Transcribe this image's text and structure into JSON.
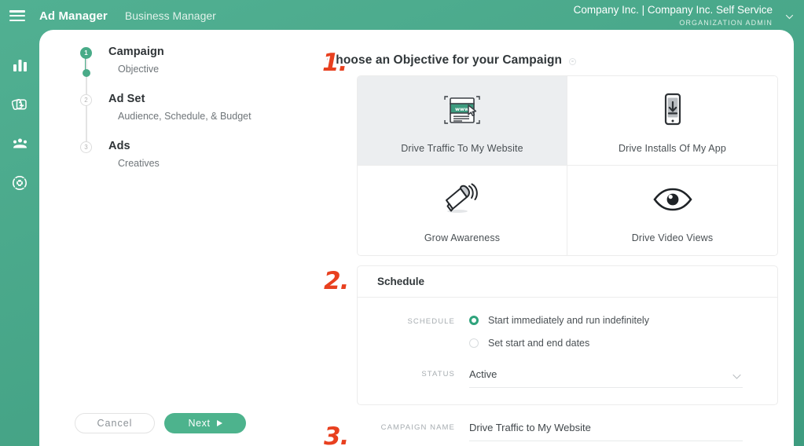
{
  "header": {
    "menu_icon": "hamburger-icon",
    "brand": "Ad Manager",
    "secondary_nav": "Business Manager",
    "org_line": "Company Inc.  |  Company Inc. Self Service",
    "org_role": "ORGANIZATION ADMIN",
    "caret_icon": "chevron-down-icon"
  },
  "rail": {
    "items": [
      {
        "icon": "bar-chart-icon",
        "name": "analytics"
      },
      {
        "icon": "ads-cards-icon",
        "name": "ads"
      },
      {
        "icon": "audience-people-icon",
        "name": "audience"
      },
      {
        "icon": "target-support-icon",
        "name": "support"
      }
    ]
  },
  "stepper": {
    "steps": [
      {
        "number": "1",
        "title": "Campaign",
        "sub": "Objective",
        "active": true
      },
      {
        "number": "2",
        "title": "Ad Set",
        "sub": "Audience, Schedule, & Budget",
        "active": false
      },
      {
        "number": "3",
        "title": "Ads",
        "sub": "Creatives",
        "active": false
      }
    ]
  },
  "footer": {
    "cancel_label": "Cancel",
    "next_label": "Next",
    "next_icon": "play-arrow-icon"
  },
  "markers": {
    "one": "1.",
    "two": "2.",
    "three": "3."
  },
  "objective_section": {
    "title": "Choose an Objective for your Campaign",
    "info_icon": "info-icon",
    "options": [
      {
        "label": "Drive Traffic To My Website",
        "icon": "browser-window-icon",
        "selected": true
      },
      {
        "label": "Drive Installs Of My App",
        "icon": "mobile-download-icon",
        "selected": false
      },
      {
        "label": "Grow Awareness",
        "icon": "megaphone-icon",
        "selected": false
      },
      {
        "label": "Drive Video Views",
        "icon": "eye-icon",
        "selected": false
      }
    ]
  },
  "schedule_section": {
    "title": "Schedule",
    "schedule_label": "SCHEDULE",
    "radio_options": [
      {
        "label": "Start immediately and run indefinitely",
        "selected": true
      },
      {
        "label": "Set start and end dates",
        "selected": false
      }
    ],
    "status_label": "STATUS",
    "status_value": "Active",
    "status_caret_icon": "chevron-down-icon"
  },
  "name_section": {
    "label": "CAMPAIGN NAME",
    "value": "Drive Traffic to My Website"
  },
  "colors": {
    "header_green": "#51b092",
    "accent_green": "#4db38d",
    "radio_green": "#2fa37c",
    "marker_red": "#e8401f",
    "selected_card_bg": "#eceef0"
  }
}
